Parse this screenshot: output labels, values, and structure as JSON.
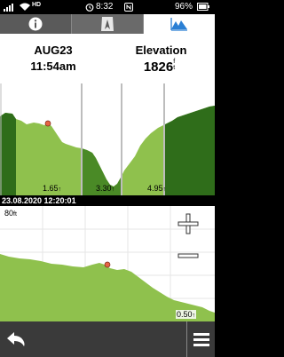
{
  "status_bar": {
    "hd_label": "HD",
    "time": "8:32",
    "battery_percent": "96%"
  },
  "tabs": [
    {
      "icon": "info-icon",
      "selected": false
    },
    {
      "icon": "compass-icon",
      "selected": false
    },
    {
      "icon": "elevation-profile-icon",
      "selected": true
    }
  ],
  "header": {
    "date": "AUG23",
    "time": "11:54am",
    "elevation_label": "Elevation",
    "elevation_value": "1826",
    "elevation_unit_top": "f",
    "elevation_unit_bottom": "t"
  },
  "overview_chart": {
    "distance_markers": [
      "1.65",
      "3.30",
      "4.95"
    ],
    "distance_unit_mark": "↑"
  },
  "timestamp": "23.08.2020 12:20:01",
  "detail_chart": {
    "scale_label": "80",
    "scale_unit": "ft",
    "distance_label": "0.50",
    "distance_unit_mark": "↑"
  },
  "colors": {
    "fill_light": "#8fc14d",
    "fill_dark": "#2f6d1a",
    "fill_shadow": "#4a8a26",
    "marker": "#e56444",
    "tab_active_icon": "#2a7fd4"
  },
  "bottom_bar": {
    "back_icon": "back-arrow-icon",
    "menu_icon": "menu-icon"
  }
}
